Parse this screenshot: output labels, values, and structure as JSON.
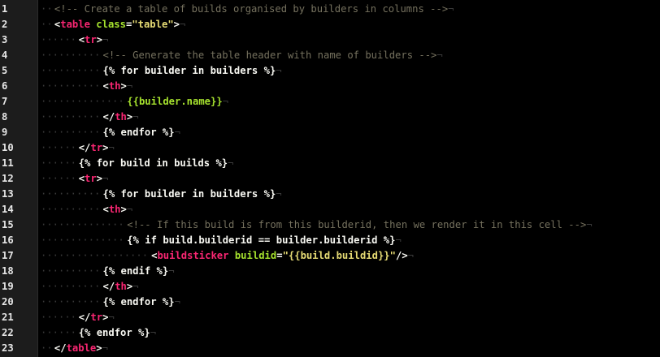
{
  "editor": {
    "theme_colors": {
      "background": "#000000",
      "gutter": "#1c1c1c",
      "comment": "#75715e",
      "tag": "#f92672",
      "attribute": "#a6e22e",
      "string": "#e6db74",
      "text": "#f8f8f2"
    },
    "lines": [
      {
        "n": "1",
        "indent": 1,
        "tokens": [
          [
            "cmt",
            "<!-- Create a table of builds organised by builders in columns -->"
          ]
        ]
      },
      {
        "n": "2",
        "indent": 1,
        "tokens": [
          [
            "punct",
            "<"
          ],
          [
            "tag",
            "table"
          ],
          [
            "punct",
            " "
          ],
          [
            "attr",
            "class"
          ],
          [
            "punct",
            "="
          ],
          [
            "str",
            "\"table\""
          ],
          [
            "punct",
            ">"
          ]
        ]
      },
      {
        "n": "3",
        "indent": 2,
        "tokens": [
          [
            "punct",
            "<"
          ],
          [
            "tag",
            "tr"
          ],
          [
            "punct",
            ">"
          ]
        ]
      },
      {
        "n": "4",
        "indent": 3,
        "tokens": [
          [
            "cmt",
            "<!-- Generate the table header with name of builders -->"
          ]
        ]
      },
      {
        "n": "5",
        "indent": 3,
        "tokens": [
          [
            "tpl",
            "{% for builder in builders %}"
          ]
        ]
      },
      {
        "n": "6",
        "indent": 3,
        "tokens": [
          [
            "punct",
            "<"
          ],
          [
            "tag",
            "th"
          ],
          [
            "punct",
            ">"
          ]
        ]
      },
      {
        "n": "7",
        "indent": 4,
        "tokens": [
          [
            "var",
            "{{builder.name}}"
          ]
        ]
      },
      {
        "n": "8",
        "indent": 3,
        "tokens": [
          [
            "punct",
            "</"
          ],
          [
            "tag",
            "th"
          ],
          [
            "punct",
            ">"
          ]
        ]
      },
      {
        "n": "9",
        "indent": 3,
        "tokens": [
          [
            "tpl",
            "{% endfor %}"
          ]
        ]
      },
      {
        "n": "10",
        "indent": 2,
        "tokens": [
          [
            "punct",
            "</"
          ],
          [
            "tag",
            "tr"
          ],
          [
            "punct",
            ">"
          ]
        ]
      },
      {
        "n": "11",
        "indent": 2,
        "tokens": [
          [
            "tpl",
            "{% for build in builds %}"
          ]
        ]
      },
      {
        "n": "12",
        "indent": 2,
        "tokens": [
          [
            "punct",
            "<"
          ],
          [
            "tag",
            "tr"
          ],
          [
            "punct",
            ">"
          ]
        ]
      },
      {
        "n": "13",
        "indent": 3,
        "tokens": [
          [
            "tpl",
            "{% for builder in builders %}"
          ]
        ]
      },
      {
        "n": "14",
        "indent": 3,
        "tokens": [
          [
            "punct",
            "<"
          ],
          [
            "tag",
            "th"
          ],
          [
            "punct",
            ">"
          ]
        ]
      },
      {
        "n": "15",
        "indent": 4,
        "tokens": [
          [
            "cmt",
            "<!-- If this build is from this builderid, then we render it in this cell -->"
          ]
        ]
      },
      {
        "n": "16",
        "indent": 4,
        "tokens": [
          [
            "tpl",
            "{% if build.builderid == builder.builderid %}"
          ]
        ]
      },
      {
        "n": "17",
        "indent": 5,
        "tokens": [
          [
            "punct",
            "<"
          ],
          [
            "tag",
            "buildsticker"
          ],
          [
            "punct",
            " "
          ],
          [
            "attr",
            "buildid"
          ],
          [
            "punct",
            "="
          ],
          [
            "str",
            "\"{{build.buildid}}\""
          ],
          [
            "punct",
            "/>"
          ]
        ]
      },
      {
        "n": "18",
        "indent": 4,
        "shift": -1,
        "tokens": [
          [
            "tpl",
            "{% endif %}"
          ]
        ]
      },
      {
        "n": "19",
        "indent": 3,
        "tokens": [
          [
            "punct",
            "</"
          ],
          [
            "tag",
            "th"
          ],
          [
            "punct",
            ">"
          ]
        ]
      },
      {
        "n": "20",
        "indent": 3,
        "tokens": [
          [
            "tpl",
            "{% endfor %}"
          ]
        ]
      },
      {
        "n": "21",
        "indent": 2,
        "tokens": [
          [
            "punct",
            "</"
          ],
          [
            "tag",
            "tr"
          ],
          [
            "punct",
            ">"
          ]
        ]
      },
      {
        "n": "22",
        "indent": 2,
        "tokens": [
          [
            "tpl",
            "{% endfor %}"
          ]
        ]
      },
      {
        "n": "23",
        "indent": 1,
        "tokens": [
          [
            "punct",
            "</"
          ],
          [
            "tag",
            "table"
          ],
          [
            "punct",
            ">"
          ]
        ]
      }
    ]
  }
}
